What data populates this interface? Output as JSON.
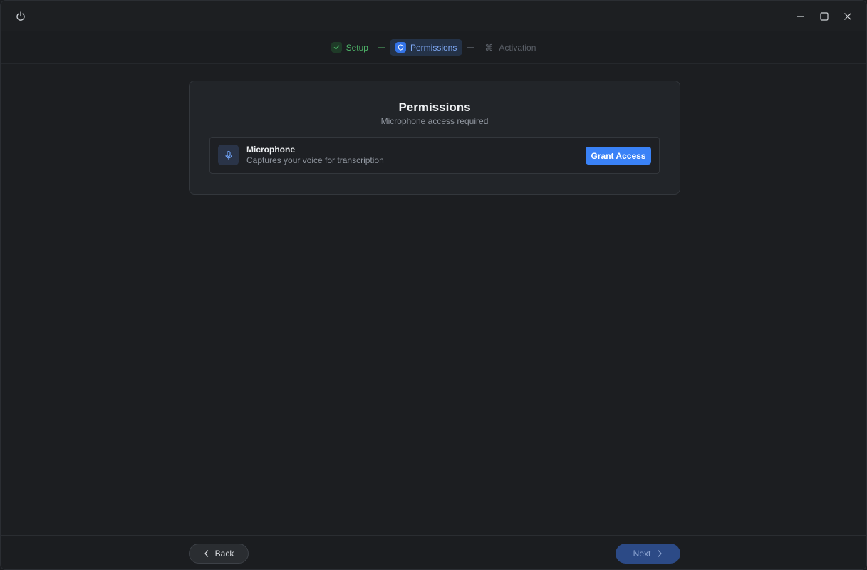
{
  "titlebar": {
    "icons": [
      "power-icon",
      "minimize-icon",
      "maximize-icon",
      "close-icon"
    ]
  },
  "stepper": {
    "steps": [
      {
        "label": "Setup",
        "state": "done",
        "icon": "check-icon"
      },
      {
        "label": "Permissions",
        "state": "active",
        "icon": "shield-icon"
      },
      {
        "label": "Activation",
        "state": "pending",
        "icon": "command-icon"
      }
    ]
  },
  "card": {
    "title": "Permissions",
    "subtitle": "Microphone access required",
    "permission": {
      "icon": "microphone-icon",
      "name": "Microphone",
      "description": "Captures your voice for transcription",
      "button_label": "Grant Access"
    }
  },
  "footer": {
    "back_label": "Back",
    "next_label": "Next"
  },
  "colors": {
    "accent": "#3a82f7",
    "success": "#4fb86a",
    "background": "#1c1e21"
  }
}
